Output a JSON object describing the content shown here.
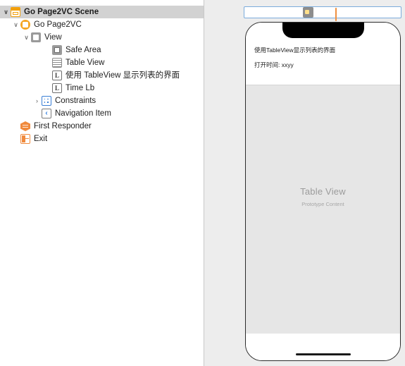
{
  "outline": {
    "name": "document-outline",
    "items": [
      {
        "label": "Go Page2VC Scene",
        "icon": "scene-icon",
        "indent": 0,
        "twisty": "open",
        "selected": true
      },
      {
        "label": "Go Page2VC",
        "icon": "view-controller-icon",
        "indent": 1,
        "twisty": "open",
        "selected": false
      },
      {
        "label": "View",
        "icon": "view-icon",
        "indent": 2,
        "twisty": "open",
        "selected": false
      },
      {
        "label": "Safe Area",
        "icon": "safe-area-icon",
        "indent": 4,
        "twisty": "none",
        "selected": false
      },
      {
        "label": "Table View",
        "icon": "table-view-icon",
        "indent": 4,
        "twisty": "none",
        "selected": false
      },
      {
        "label": "使用 TableView 显示列表的界面",
        "icon": "label-icon",
        "icon_text": "L",
        "indent": 4,
        "twisty": "none",
        "selected": false
      },
      {
        "label": "Time Lb",
        "icon": "label-icon",
        "icon_text": "L",
        "indent": 4,
        "twisty": "none",
        "selected": false
      },
      {
        "label": "Constraints",
        "icon": "constraints-icon",
        "indent": 3,
        "twisty": "closed",
        "selected": false
      },
      {
        "label": "Navigation Item",
        "icon": "navigation-item-icon",
        "icon_text": "‹",
        "indent": 3,
        "twisty": "none",
        "selected": false
      },
      {
        "label": "First Responder",
        "icon": "first-responder-icon",
        "indent": 1,
        "twisty": "none",
        "selected": false
      },
      {
        "label": "Exit",
        "icon": "exit-icon",
        "indent": 1,
        "twisty": "none",
        "selected": false
      }
    ],
    "twisty_open": "∨",
    "twisty_closed": "›"
  },
  "canvas": {
    "name": "interface-builder-canvas",
    "background_color": "#ededed",
    "scene_dock": {
      "items": [
        {
          "name": "dock-view-controller-icon",
          "selected": true
        },
        {
          "name": "dock-first-responder-icon",
          "selected": false
        },
        {
          "name": "dock-exit-icon",
          "selected": false
        }
      ],
      "border_color": "#7bacdc"
    },
    "phone": {
      "device_label": "iPhone preview",
      "labels": {
        "title": "使用TableView显示列表的界面",
        "time": "打开时间: xxyy"
      },
      "table_view": {
        "title": "Table View",
        "subtitle": "Prototype Content",
        "background_color": "#e6e6e6"
      }
    }
  }
}
